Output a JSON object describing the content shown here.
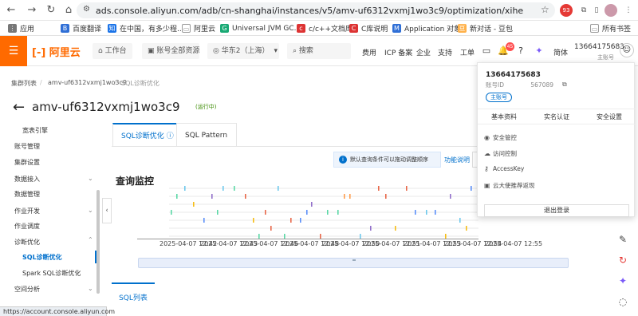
{
  "browser": {
    "url": "ads.console.aliyun.com/adb/cn-shanghai/instances/v5/amv-uf6312vxmj1wo3c9/optimization/xihe",
    "ext_badge": "93",
    "bookmarks": [
      "应用",
      "百度翻译",
      "在中国，有多少程...",
      "阿里云",
      "Universal JVM GC...",
      "c/c++文档库",
      "C库说明",
      "Application 对象",
      "新对话 - 豆包"
    ],
    "all_bookmarks": "所有书签",
    "status_url": "https://account.console.aliyun.com"
  },
  "header": {
    "logo": "[-] 阿里云",
    "workbench": "工作台",
    "account_select": "账号全部资源",
    "region": "华东2（上海）",
    "search_placeholder": "搜索",
    "links": [
      "费用",
      "ICP 备案",
      "企业",
      "支持",
      "工单"
    ],
    "notif_count": "45",
    "lang": "简体",
    "user_phone": "13664175683",
    "user_role": "主账号"
  },
  "breadcrumb": [
    "集群列表",
    "amv-uf6312vxmj1wo3c9",
    "SQL诊断优化"
  ],
  "page": {
    "title": "amv-uf6312vxmj1wo3c9",
    "status": "(运行中)"
  },
  "sidebar": {
    "items": [
      {
        "label": "宽表引擎"
      },
      {
        "label": "账号管理"
      },
      {
        "label": "集群设置"
      },
      {
        "label": "数据接入"
      },
      {
        "label": "数据管理"
      },
      {
        "label": "作业开发"
      },
      {
        "label": "作业调度"
      },
      {
        "label": "诊断优化"
      },
      {
        "label": "SQL诊断优化"
      },
      {
        "label": "Spark SQL诊断优化"
      },
      {
        "label": "空间分析"
      }
    ]
  },
  "tabs": [
    {
      "label": "SQL诊断优化"
    },
    {
      "label": "SQL Pattern"
    }
  ],
  "tip": "默认查询条件可以拖动调整顺序",
  "func_link": "功能说明",
  "section_title": "查询监控",
  "chart_data": {
    "type": "scatter",
    "title": "",
    "x_ticks": [
      "2025-04-07 12:42",
      "2025-04-07 12:43",
      "2025-04-07 12:46",
      "2025-04-07 12:48",
      "2025-04-07 12:50",
      "2025-04-07 12:51",
      "2025-04-07 12:53",
      "2025-04-07 12:54",
      "2025-04-07 12:55"
    ],
    "series_colors": [
      "#5b8ff9",
      "#f6bd16",
      "#e8684a",
      "#5ad8a6",
      "#9270ca",
      "#ff9d4d",
      "#6dc8ec"
    ]
  },
  "bottom_tab": "SQL列表",
  "dropdown": {
    "phone": "13664175683",
    "account_id_label": "账号ID",
    "account_id_value": "567089",
    "role": "主账号",
    "tabs": [
      "基本资料",
      "实名认证",
      "安全设置"
    ],
    "menu": [
      "安全管控",
      "访问控制",
      "AccessKey",
      "云大使推荐返现"
    ],
    "logout": "退出登录"
  }
}
